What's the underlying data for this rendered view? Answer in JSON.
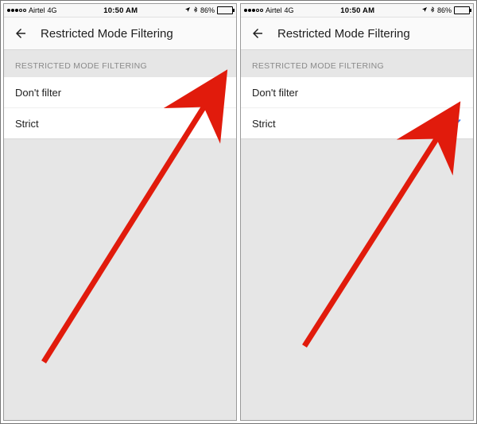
{
  "statusbar": {
    "carrier": "Airtel",
    "network": "4G",
    "time": "10:50 AM",
    "battery_pct": "86%"
  },
  "header": {
    "title": "Restricted Mode Filtering"
  },
  "section": {
    "title": "RESTRICTED MODE FILTERING",
    "options": [
      {
        "label": "Don't filter"
      },
      {
        "label": "Strict"
      }
    ]
  },
  "panels": {
    "left": {
      "selected_index": 0
    },
    "right": {
      "selected_index": 1
    }
  },
  "colors": {
    "check_blue": "#3B82F6",
    "arrow_red": "#E11B0C"
  }
}
